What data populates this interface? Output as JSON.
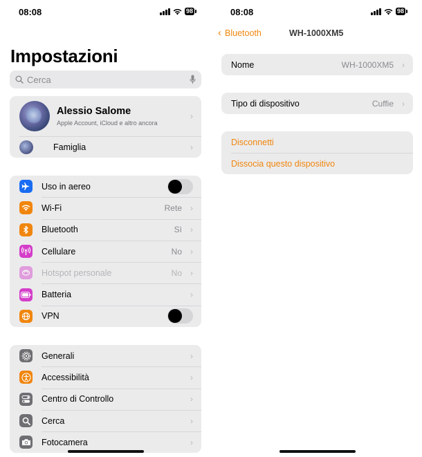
{
  "left": {
    "status": {
      "time": "08:08",
      "battery": "98"
    },
    "title": "Impostazioni",
    "search": {
      "placeholder": "Cerca"
    },
    "profile": {
      "name": "Alessio Salome",
      "subtitle": "Apple Account, iCloud e altro ancora",
      "family_label": "Famiglia"
    },
    "group1": [
      {
        "label": "Uso in aereo",
        "icon": "airplane-icon",
        "color": "#1a6cf2",
        "type": "toggle",
        "on": false
      },
      {
        "label": "Wi-Fi",
        "icon": "wifi-icon",
        "color": "#f0860e",
        "value": "Rete"
      },
      {
        "label": "Bluetooth",
        "icon": "bluetooth-icon",
        "color": "#f0860e",
        "value": "Sì"
      },
      {
        "label": "Cellulare",
        "icon": "antenna-icon",
        "color": "#d43ec9",
        "value": "No"
      },
      {
        "label": "Hotspot personale",
        "icon": "hotspot-icon",
        "color": "#d43ec9",
        "value": "No",
        "disabled": true
      },
      {
        "label": "Batteria",
        "icon": "battery-icon",
        "color": "#d43ec9",
        "value": ""
      },
      {
        "label": "VPN",
        "icon": "globe-icon",
        "color": "#f0860e",
        "type": "toggle",
        "on": false
      }
    ],
    "group2": [
      {
        "label": "Generali",
        "icon": "gear-icon",
        "color": "#6f6f73"
      },
      {
        "label": "Accessibilità",
        "icon": "accessibility-icon",
        "color": "#f0860e"
      },
      {
        "label": "Centro di Controllo",
        "icon": "switches-icon",
        "color": "#6f6f73"
      },
      {
        "label": "Cerca",
        "icon": "search-icon",
        "color": "#6f6f73"
      },
      {
        "label": "Fotocamera",
        "icon": "camera-icon",
        "color": "#6f6f73"
      }
    ]
  },
  "right": {
    "status": {
      "time": "08:08",
      "battery": "98"
    },
    "nav": {
      "back_label": "Bluetooth",
      "title": "WH-1000XM5"
    },
    "name_row": {
      "label": "Nome",
      "value": "WH-1000XM5"
    },
    "type_row": {
      "label": "Tipo di dispositivo",
      "value": "Cuffie"
    },
    "actions": {
      "disconnect": "Disconnetti",
      "forget": "Dissocia questo dispositivo"
    },
    "accent": "#f0860e"
  }
}
